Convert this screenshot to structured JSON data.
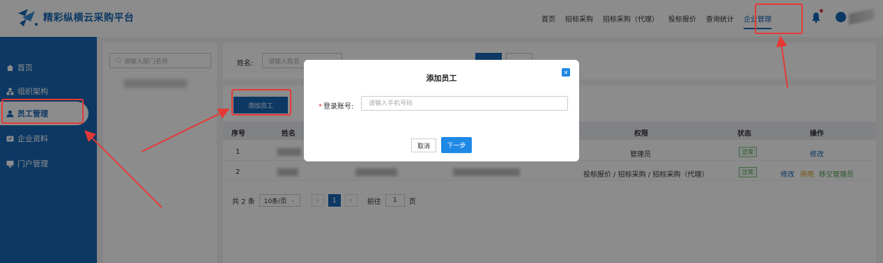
{
  "header": {
    "brand": "精彩纵横云采购平台",
    "nav": [
      "首页",
      "招标采购",
      "招标采购（代理）",
      "投标报价",
      "查询统计",
      "企业管理"
    ],
    "active_nav": "企业管理"
  },
  "sidebar": {
    "items": [
      {
        "label": "首页",
        "icon": "home-icon"
      },
      {
        "label": "组织架构",
        "icon": "org-tree-icon"
      },
      {
        "label": "员工管理",
        "icon": "user-icon",
        "active": true
      },
      {
        "label": "企业资料",
        "icon": "profile-card-icon"
      },
      {
        "label": "门户管理",
        "icon": "portal-icon"
      }
    ]
  },
  "dept": {
    "search_placeholder": "请输入部门名称"
  },
  "filter": {
    "name_label": "姓名:",
    "name_placeholder": "请输入姓名"
  },
  "toolbar": {
    "add_employee": "添加员工"
  },
  "table": {
    "columns": {
      "index": "序号",
      "name": "姓名",
      "permission": "权限",
      "status": "状态",
      "actions": "操作"
    },
    "rows": [
      {
        "index": "1",
        "permission": "管理员",
        "status": "正常",
        "actions": [
          "修改"
        ]
      },
      {
        "index": "2",
        "permission": "投标报价 / 招标采购 / 招标采购（代理）",
        "status": "正常",
        "actions": [
          "修改",
          "停用",
          "移交管理员"
        ]
      }
    ]
  },
  "pager": {
    "total": "共 2 条",
    "page_size": "10条/页",
    "current_page": "1",
    "goto_label": "前往",
    "goto_value": "1",
    "page_unit": "页"
  },
  "modal": {
    "title": "添加员工",
    "field_label": "登录账号:",
    "field_placeholder": "请输入手机号码",
    "cancel": "取消",
    "next": "下一步"
  },
  "colors": {
    "brand_blue": "#1766b5",
    "accent_blue": "#1e88e5",
    "annotation_red": "#e53935"
  }
}
